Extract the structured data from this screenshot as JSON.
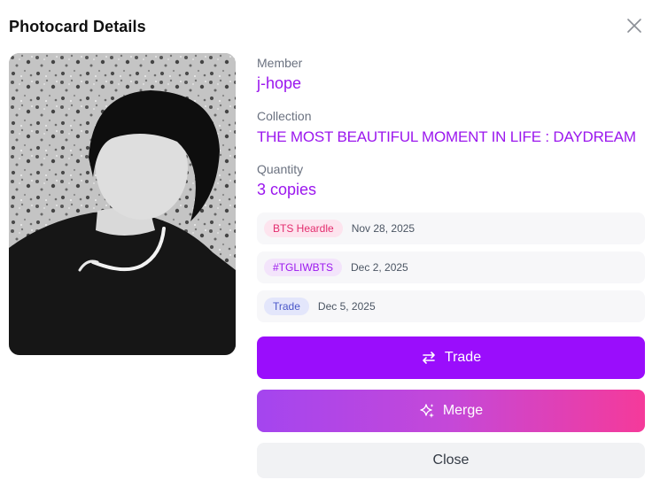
{
  "dialog": {
    "title": "Photocard Details"
  },
  "photo": {
    "alt": "j-hope photocard (black and white portrait)"
  },
  "details": {
    "member_label": "Member",
    "member_value": "j-hope",
    "collection_label": "Collection",
    "collection_value": "THE MOST BEAUTIFUL MOMENT IN LIFE : DAYDREAM",
    "quantity_label": "Quantity",
    "quantity_value": "3 copies"
  },
  "history": [
    {
      "badge": "BTS Heardle",
      "date": "Nov 28, 2025"
    },
    {
      "badge": "#TGLIWBTS",
      "date": "Dec 2, 2025"
    },
    {
      "badge": "Trade",
      "date": "Dec 5, 2025"
    }
  ],
  "buttons": {
    "trade_label": "Trade",
    "merge_label": "Merge",
    "close_label": "Close"
  },
  "colors": {
    "accent": "#9a0dfc",
    "value_text": "#9b17ee",
    "merge_gradient_start": "#a445ef",
    "merge_gradient_end": "#f53a9a"
  },
  "icons": [
    "close-icon",
    "trade-arrows-icon",
    "sparkles-icon"
  ]
}
